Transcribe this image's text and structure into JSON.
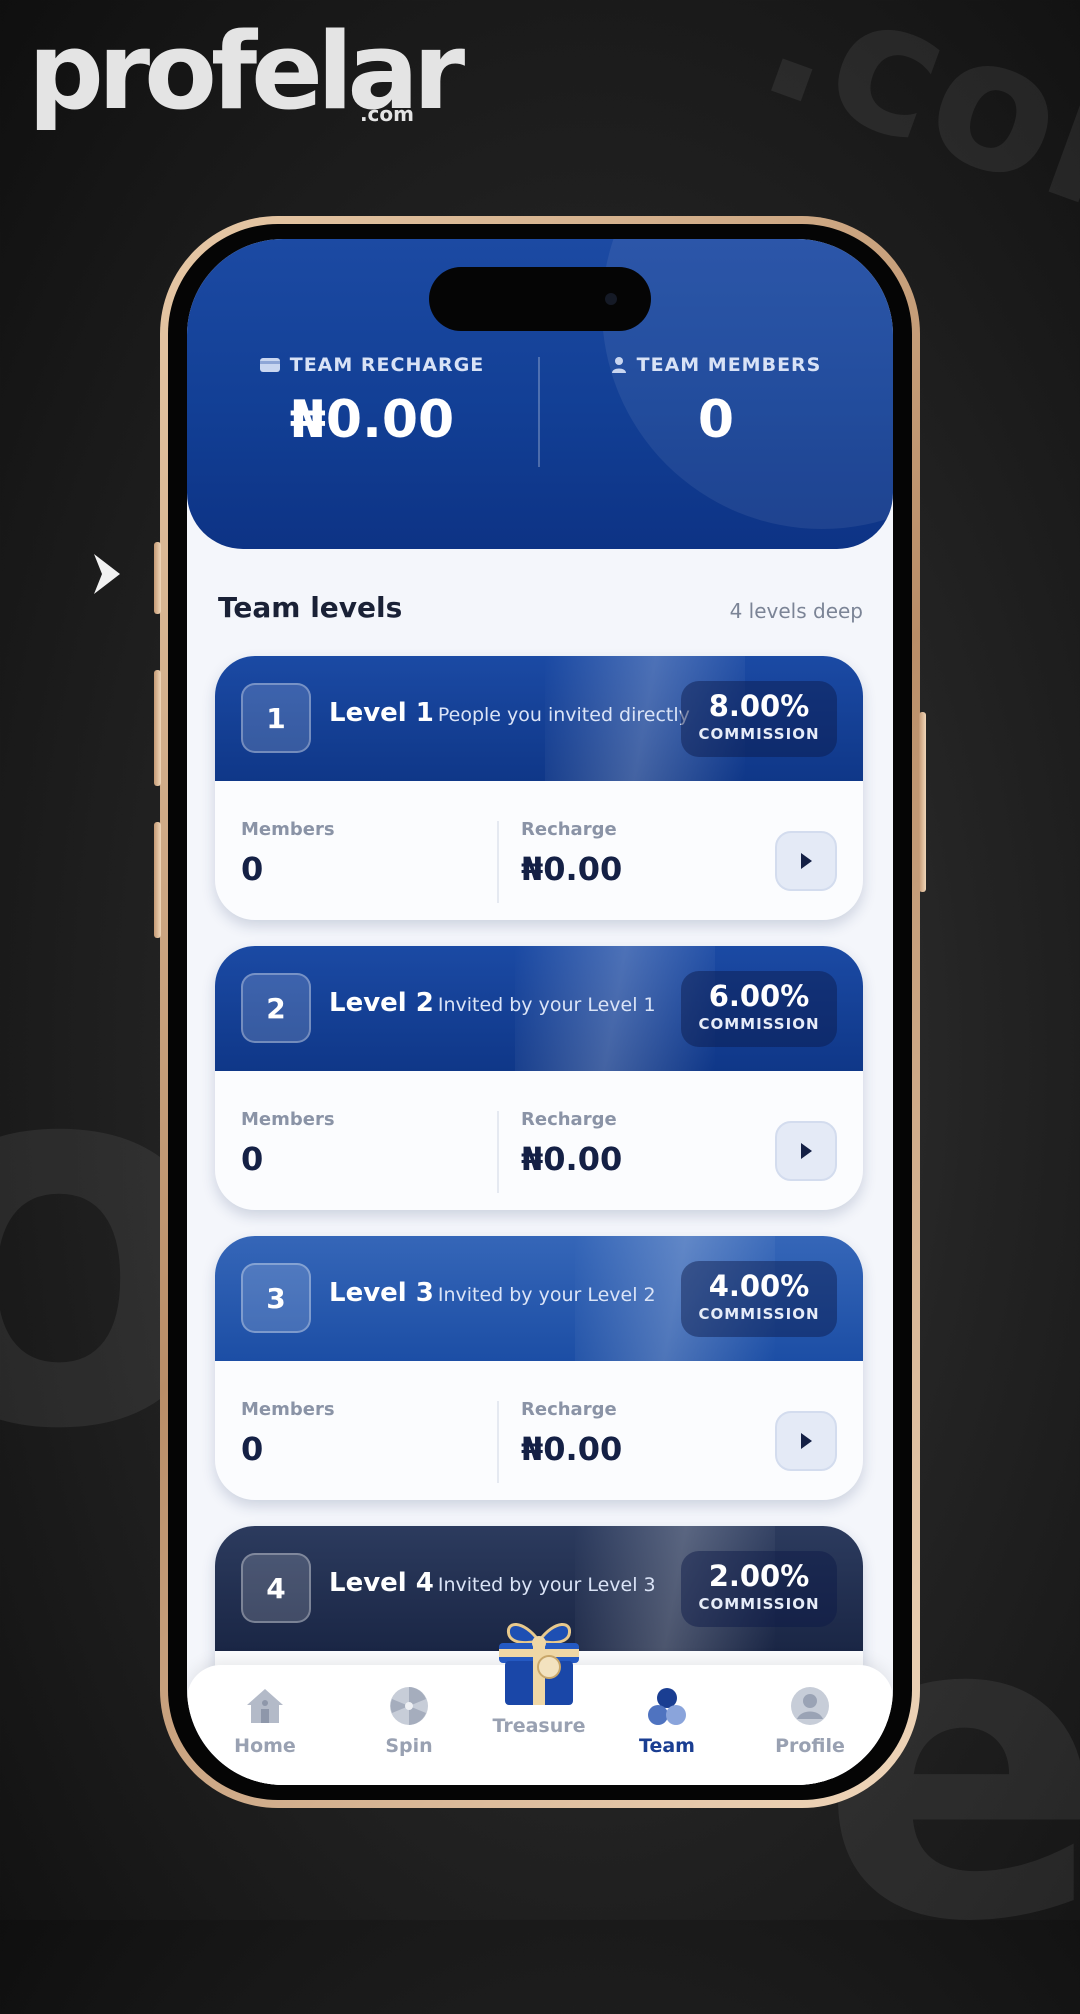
{
  "brand": {
    "name": "profelar",
    "suffix": ".com"
  },
  "header": {
    "team_recharge": {
      "label": "TEAM RECHARGE",
      "value": "₦0.00",
      "icon": "wallet-icon"
    },
    "team_members": {
      "label": "TEAM MEMBERS",
      "value": "0",
      "icon": "person-icon"
    }
  },
  "team_levels": {
    "title": "Team levels",
    "subtitle": "4 levels deep",
    "levels": [
      {
        "num": "1",
        "name": "Level 1",
        "desc": "People you invited directly",
        "commission": "8.00%",
        "commission_label": "COMMISSION",
        "members_label": "Members",
        "members": "0",
        "recharge_label": "Recharge",
        "recharge": "₦0.00",
        "color": "#123d93"
      },
      {
        "num": "2",
        "name": "Level 2",
        "desc": "Invited by your Level 1",
        "commission": "6.00%",
        "commission_label": "COMMISSION",
        "members_label": "Members",
        "members": "0",
        "recharge_label": "Recharge",
        "recharge": "₦0.00",
        "color": "#123d93"
      },
      {
        "num": "3",
        "name": "Level 3",
        "desc": "Invited by your Level 2",
        "commission": "4.00%",
        "commission_label": "COMMISSION",
        "members_label": "Members",
        "members": "0",
        "recharge_label": "Recharge",
        "recharge": "₦0.00",
        "color": "#2a5bb0"
      },
      {
        "num": "4",
        "name": "Level 4",
        "desc": "Invited by your Level 3",
        "commission": "2.00%",
        "commission_label": "COMMISSION",
        "color": "#1f2d4f"
      }
    ]
  },
  "nav": {
    "home": "Home",
    "spin": "Spin",
    "treasure": "Treasure",
    "team": "Team",
    "profile": "Profile",
    "active": "Team"
  },
  "colors": {
    "primary": "#123f95",
    "active_nav": "#1a3e92",
    "text_dark": "#142045"
  }
}
